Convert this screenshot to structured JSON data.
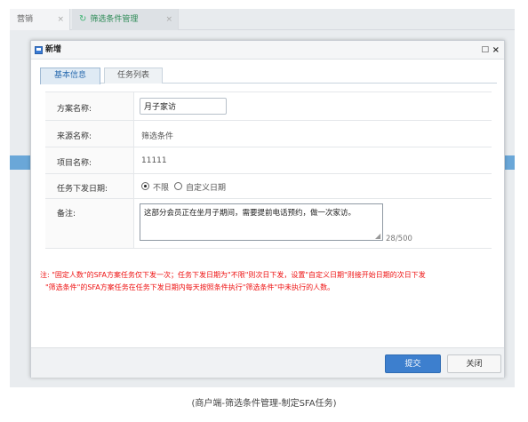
{
  "app_tabs": [
    {
      "label": "营销",
      "close": "×"
    },
    {
      "label": "筛选条件管理",
      "close": "×"
    }
  ],
  "dialog": {
    "title": "新增",
    "maximize": "□",
    "close": "×"
  },
  "tabs": [
    {
      "label": "基本信息",
      "active": true
    },
    {
      "label": "任务列表",
      "active": false
    }
  ],
  "form": {
    "scheme_name": {
      "label": "方案名称:",
      "value": "月子家访"
    },
    "source_name": {
      "label": "来源名称:",
      "value": "筛选条件"
    },
    "project_name": {
      "label": "项目名称:",
      "value": "11111"
    },
    "issue_date": {
      "label": "任务下发日期:",
      "options": [
        {
          "label": "不限",
          "selected": true
        },
        {
          "label": "自定义日期",
          "selected": false
        }
      ]
    },
    "remark": {
      "label": "备注:",
      "value": "这部分会员正在坐月子期间，需要提前电话预约，做一次家访。",
      "counter": "28/500"
    }
  },
  "note": {
    "line1": "注: \"固定人数\"的SFA方案任务仅下发一次；任务下发日期为\"不限\"则次日下发，设置\"自定义日期\"则接开始日期的次日下发",
    "line2": "\"筛选条件\"的SFA方案任务在任务下发日期内每天按照条件执行\"筛选条件\"中未执行的人数。"
  },
  "footer": {
    "submit_label": "提交",
    "close_label": "关闭"
  },
  "caption": "(商户端-筛选条件管理-制定SFA任务)",
  "colors": {
    "accent": "#3d7fce",
    "note_text": "#ee1111",
    "active_tab_text": "#2b6cb0",
    "app_tab_active": "#2e8b57"
  }
}
